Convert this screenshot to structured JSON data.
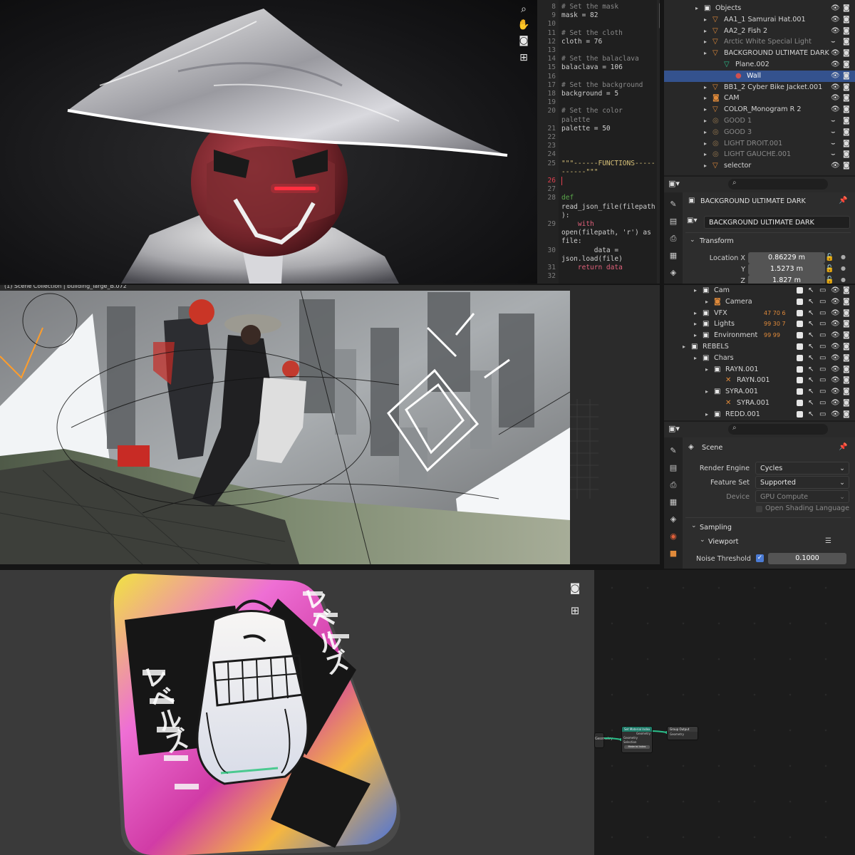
{
  "colors": {
    "accent_select": "#34528e",
    "object_orange": "#e08a3a",
    "mesh_green": "#2bbf8a",
    "code_number": "#67b7e8",
    "code_keyword": "#e0607a",
    "cursor_line": "#e04050"
  },
  "viewport_top": {
    "tools": [
      "zoom-icon",
      "hand-icon",
      "camera-icon",
      "grid-icon"
    ]
  },
  "editor": {
    "lines": [
      {
        "n": "8",
        "text": "# Set the mask",
        "kind": "comment"
      },
      {
        "n": "9",
        "text": "mask = 82",
        "kind": "assign"
      },
      {
        "n": "10",
        "text": "",
        "kind": "blank"
      },
      {
        "n": "11",
        "text": "# Set the cloth",
        "kind": "comment"
      },
      {
        "n": "12",
        "text": "cloth = 76",
        "kind": "assign"
      },
      {
        "n": "13",
        "text": "",
        "kind": "blank"
      },
      {
        "n": "14",
        "text": "# Set the balaclava",
        "kind": "comment"
      },
      {
        "n": "15",
        "text": "balaclava = 106",
        "kind": "assign"
      },
      {
        "n": "16",
        "text": "",
        "kind": "blank"
      },
      {
        "n": "17",
        "text": "# Set the background",
        "kind": "comment"
      },
      {
        "n": "18",
        "text": "background = 5",
        "kind": "assign"
      },
      {
        "n": "19",
        "text": "",
        "kind": "blank"
      },
      {
        "n": "20",
        "text": "# Set the color",
        "kind": "comment"
      },
      {
        "n": "",
        "text": "palette",
        "kind": "comment"
      },
      {
        "n": "21",
        "text": "palette = 50",
        "kind": "assign"
      },
      {
        "n": "22",
        "text": "",
        "kind": "blank"
      },
      {
        "n": "23",
        "text": "",
        "kind": "blank"
      },
      {
        "n": "24",
        "text": "",
        "kind": "blank"
      },
      {
        "n": "25",
        "text": "\"\"\"------FUNCTIONS-----",
        "kind": "str"
      },
      {
        "n": "",
        "text": "------\"\"\"",
        "kind": "str"
      },
      {
        "n": "26",
        "text": "",
        "kind": "cursor"
      },
      {
        "n": "27",
        "text": "",
        "kind": "blank"
      },
      {
        "n": "28",
        "text": "def",
        "kind": "def"
      },
      {
        "n": "",
        "text": "read_json_file(filepath",
        "kind": "plain"
      },
      {
        "n": "",
        "text": "):",
        "kind": "plain"
      },
      {
        "n": "29",
        "text": "    with",
        "kind": "kw"
      },
      {
        "n": "",
        "text": "open(filepath, 'r') as",
        "kind": "plain"
      },
      {
        "n": "",
        "text": "file:",
        "kind": "plain"
      },
      {
        "n": "30",
        "text": "        data =",
        "kind": "plain"
      },
      {
        "n": "",
        "text": "json.load(file)",
        "kind": "plain"
      },
      {
        "n": "31",
        "text": "    return data",
        "kind": "kw"
      },
      {
        "n": "32",
        "text": "",
        "kind": "blank"
      }
    ]
  },
  "outliner_top": {
    "rows": [
      {
        "label": "Objects",
        "type": "collection",
        "state": "normal"
      },
      {
        "label": "AA1_1 Samurai Hat.001",
        "type": "object",
        "state": "normal"
      },
      {
        "label": "AA2_2 Fish 2",
        "type": "object",
        "state": "normal"
      },
      {
        "label": "Arctic White Special Light",
        "type": "object",
        "state": "dim"
      },
      {
        "label": "BACKGROUND ULTIMATE DARK",
        "type": "object",
        "state": "normal"
      },
      {
        "label": "Plane.002",
        "type": "mesh",
        "state": "normal"
      },
      {
        "label": "Wall",
        "type": "material",
        "state": "selected"
      },
      {
        "label": "BB1_2 Cyber Bike Jacket.001",
        "type": "object",
        "state": "normal"
      },
      {
        "label": "CAM",
        "type": "camera",
        "state": "normal"
      },
      {
        "label": "COLOR_Monogram R 2",
        "type": "object",
        "state": "normal"
      },
      {
        "label": "GOOD 1",
        "type": "light",
        "state": "dim"
      },
      {
        "label": "GOOD 3",
        "type": "light",
        "state": "dim"
      },
      {
        "label": "LIGHT DROIT.001",
        "type": "light",
        "state": "dim"
      },
      {
        "label": "LIGHT GAUCHE.001",
        "type": "light",
        "state": "dim"
      },
      {
        "label": "selector",
        "type": "object",
        "state": "normal"
      }
    ]
  },
  "properties_top": {
    "object_name": "BACKGROUND ULTIMATE DARK",
    "data_name": "BACKGROUND ULTIMATE DARK",
    "section": "Transform",
    "location_label": "Location X",
    "y_label": "Y",
    "z_label": "Z",
    "location_x": "0.86229 m",
    "location_y": "1.5273 m",
    "location_z": "1.827 m"
  },
  "viewport_mid": {
    "header_text": "(1) Scene Collection | building_large_B.072"
  },
  "outliner_mid": {
    "rows": [
      {
        "label": "Cam",
        "type": "collection",
        "badge": ""
      },
      {
        "label": "Camera",
        "type": "camera",
        "badge": ""
      },
      {
        "label": "VFX",
        "type": "collection",
        "badge": "47 70 6"
      },
      {
        "label": "Lights",
        "type": "collection",
        "badge": "99 30 7"
      },
      {
        "label": "Environment",
        "type": "collection",
        "badge": "99 99"
      },
      {
        "label": "REBELS",
        "type": "collection",
        "badge": ""
      },
      {
        "label": "Chars",
        "type": "collection",
        "badge": ""
      },
      {
        "label": "RAYN.001",
        "type": "collection",
        "badge": ""
      },
      {
        "label": "RAYN.001",
        "type": "armature",
        "badge": ""
      },
      {
        "label": "SYRA.001",
        "type": "collection",
        "badge": ""
      },
      {
        "label": "SYRA.001",
        "type": "armature",
        "badge": ""
      },
      {
        "label": "REDD.001",
        "type": "collection",
        "badge": ""
      }
    ]
  },
  "properties_mid": {
    "context": "Scene",
    "render_engine_label": "Render Engine",
    "render_engine": "Cycles",
    "feature_set_label": "Feature Set",
    "feature_set": "Supported",
    "device_label": "Device",
    "device": "GPU Compute",
    "osl_label": "Open Shading Language",
    "sampling": "Sampling",
    "viewport": "Viewport",
    "noise_threshold_label": "Noise Threshold",
    "noise_threshold": "0.1000"
  },
  "sticker": {
    "text_vertical": "レベルズ"
  },
  "node_editor": {
    "node_title": "Set Material Index",
    "node_output": "Group Output",
    "socket_geometry": "Geometry",
    "socket_selection": "Selection",
    "socket_index": "Material Index",
    "input_label": "Geometry"
  }
}
